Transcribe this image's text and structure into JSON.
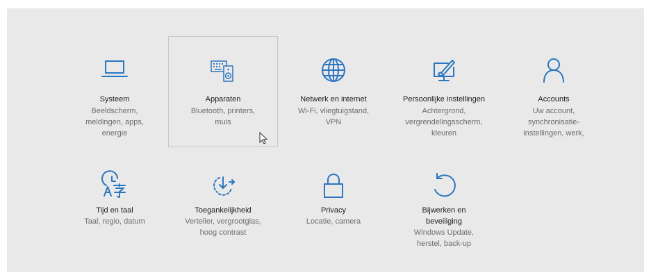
{
  "tiles": [
    {
      "title": "Systeem",
      "desc": "Beeldscherm,\nmeldingen, apps,\nenergie",
      "icon": "laptop-icon"
    },
    {
      "title": "Apparaten",
      "desc": "Bluetooth, printers,\nmuis",
      "icon": "devices-icon"
    },
    {
      "title": "Netwerk en internet",
      "desc": "Wi-Fi, vliegtuigstand,\nVPN",
      "icon": "globe-icon"
    },
    {
      "title": "Persoonlijke instellingen",
      "desc": "Achtergrond,\nvergrendelingsscherm,\nkleuren",
      "icon": "paint-icon"
    },
    {
      "title": "Accounts",
      "desc": "Uw account,\nsynchronisatie-\ninstellingen, werk,",
      "icon": "person-icon"
    },
    {
      "title": "Tijd en taal",
      "desc": "Taal, regio, datum",
      "icon": "time-language-icon"
    },
    {
      "title": "Toegankelijkheid",
      "desc": "Verteller, vergrootglas,\nhoog contrast",
      "icon": "ease-of-access-icon"
    },
    {
      "title": "Privacy",
      "desc": "Locatie, camera",
      "icon": "lock-icon"
    },
    {
      "title": "Bijwerken en\nbeveiliging",
      "desc": "Windows Update,\nherstel, back-up",
      "icon": "update-icon"
    }
  ],
  "colors": {
    "accent": "#2a76c1",
    "background": "#e9e9e9",
    "selected_border": "#c7c7c7"
  }
}
